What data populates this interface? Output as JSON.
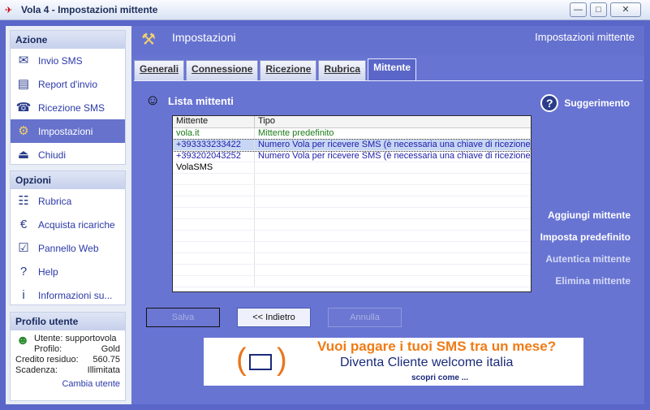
{
  "window": {
    "title": "Vola 4 - Impostazioni mittente",
    "min": "—",
    "max": "□",
    "close": "✕"
  },
  "sidebar": {
    "azione": {
      "title": "Azione",
      "items": [
        {
          "label": "Invio SMS",
          "icon": "send-sms-icon",
          "glyph": "✉"
        },
        {
          "label": "Report d'invio",
          "icon": "report-icon",
          "glyph": "▤"
        },
        {
          "label": "Ricezione SMS",
          "icon": "receive-sms-icon",
          "glyph": "☎"
        },
        {
          "label": "Impostazioni",
          "icon": "settings-icon",
          "glyph": "⚙",
          "active": true
        },
        {
          "label": "Chiudi",
          "icon": "exit-icon",
          "glyph": "⏏"
        }
      ]
    },
    "opzioni": {
      "title": "Opzioni",
      "items": [
        {
          "label": "Rubrica",
          "icon": "address-book-icon",
          "glyph": "☷"
        },
        {
          "label": "Acquista ricariche",
          "icon": "buy-credit-icon",
          "glyph": "€"
        },
        {
          "label": "Pannello Web",
          "icon": "web-panel-icon",
          "glyph": "☑"
        },
        {
          "label": "Help",
          "icon": "help-icon",
          "glyph": "?"
        },
        {
          "label": "Informazioni su...",
          "icon": "info-icon",
          "glyph": "i"
        }
      ]
    },
    "profilo": {
      "title": "Profilo utente",
      "utente": "Utente: supportovola",
      "profilo_label": "Profilo:",
      "profilo_value": "Gold",
      "credito_label": "Credito residuo:",
      "credito_value": "560.75",
      "scadenza_label": "Scadenza:",
      "scadenza_value": "Illimitata",
      "cambia": "Cambia utente"
    }
  },
  "main": {
    "title": "Impostazioni",
    "title_right": "Impostazioni mittente",
    "tabs": [
      {
        "label": "Generali",
        "key": "e"
      },
      {
        "label": "Connessione",
        "key": "C"
      },
      {
        "label": "Ricezione",
        "key": "R"
      },
      {
        "label": "Rubrica",
        "key": "R"
      },
      {
        "label": "Mittente",
        "active": true
      }
    ],
    "list_title": "Lista mittenti",
    "hint": "Suggerimento",
    "table": {
      "headers": [
        "Mittente",
        "Tipo"
      ],
      "rows": [
        {
          "mittente": "vola.it",
          "tipo": "Mittente predefinito",
          "style": "green"
        },
        {
          "mittente": "+393333233422",
          "tipo": "Numero Vola per ricevere SMS (è necessaria una chiave di ricezione)",
          "style": "blue",
          "selected": true
        },
        {
          "mittente": "+393202043252",
          "tipo": "Numero Vola per ricevere SMS (è necessaria una chiave di ricezione)",
          "style": "blue"
        },
        {
          "mittente": "VolaSMS",
          "tipo": "",
          "style": "black"
        }
      ]
    },
    "actions": {
      "aggiungi": "Aggiungi mittente",
      "imposta": "Imposta predefinito",
      "autentica": "Autentica mittente",
      "elimina": "Elimina mittente"
    },
    "buttons": {
      "salva": "Salva",
      "indietro": "<<  Indietro",
      "annulla": "Annulla"
    },
    "banner": {
      "line1": "Vuoi pagare i tuoi SMS tra un mese?",
      "line2": "Diventa Cliente welcome italia",
      "line3": "scopri come ..."
    }
  }
}
